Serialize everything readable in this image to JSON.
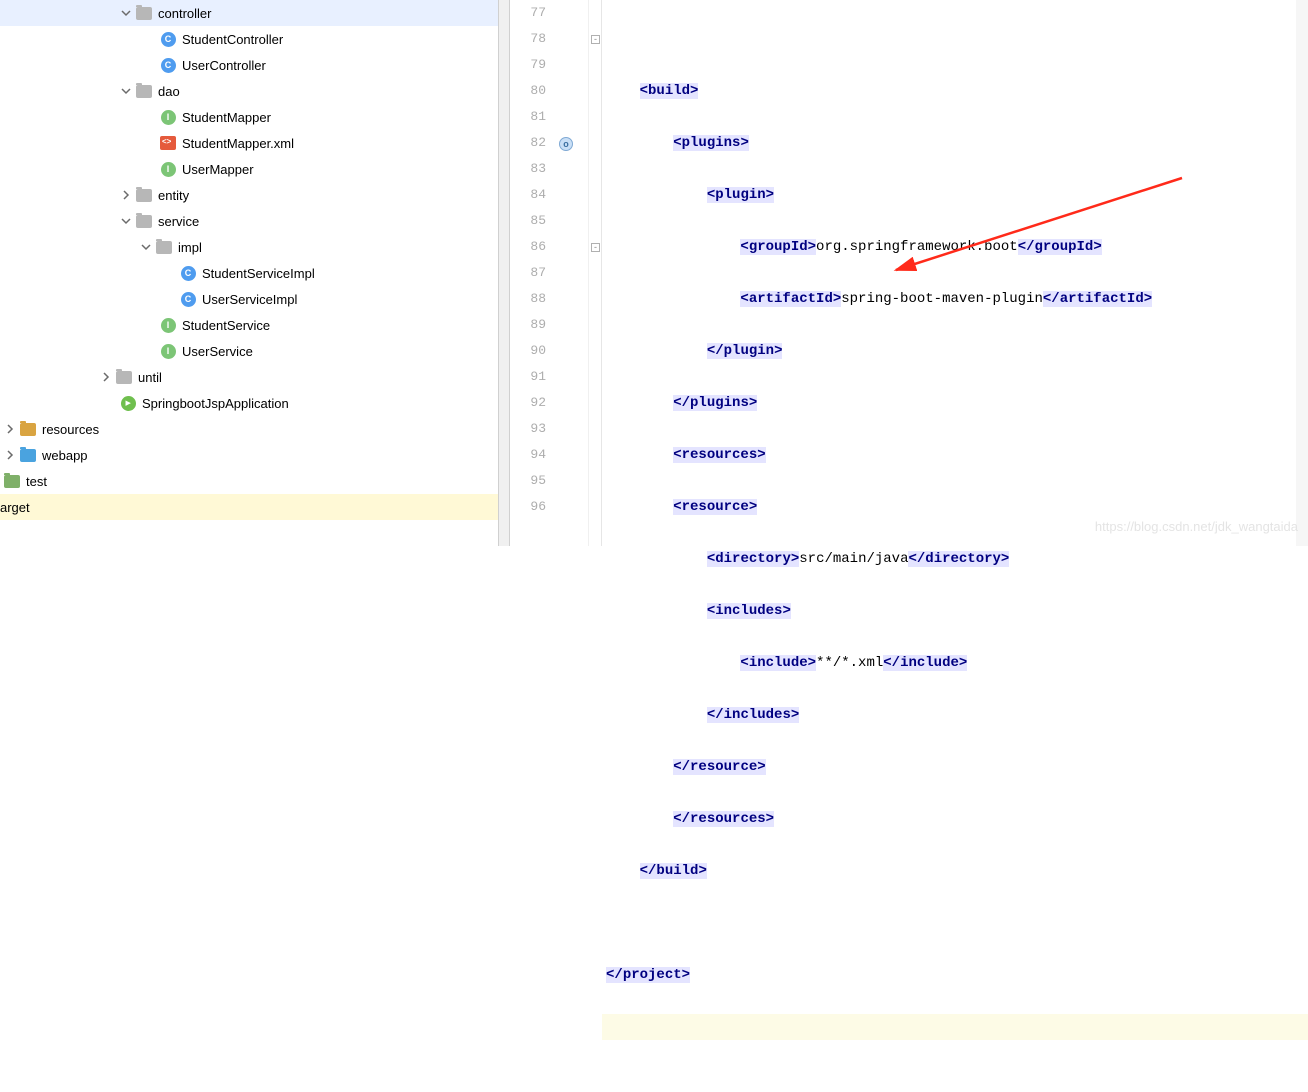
{
  "tree": {
    "controller": "controller",
    "studentController": "StudentController",
    "userController": "UserController",
    "dao": "dao",
    "studentMapper": "StudentMapper",
    "studentMapperXml": "StudentMapper.xml",
    "userMapper": "UserMapper",
    "entity": "entity",
    "service": "service",
    "impl": "impl",
    "studentServiceImpl": "StudentServiceImpl",
    "userServiceImpl": "UserServiceImpl",
    "studentService": "StudentService",
    "userService": "UserService",
    "until": "until",
    "springbootApp": "SpringbootJspApplication",
    "resources": "resources",
    "webapp": "webapp",
    "test": "test",
    "target": "arget"
  },
  "lines": {
    "l77": "77",
    "l78": "78",
    "l79": "79",
    "l80": "80",
    "l81": "81",
    "l82": "82",
    "l83": "83",
    "l84": "84",
    "l85": "85",
    "l86": "86",
    "l87": "87",
    "l88": "88",
    "l89": "89",
    "l90": "90",
    "l91": "91",
    "l92": "92",
    "l93": "93",
    "l94": "94",
    "l95": "95",
    "l96": "96"
  },
  "code": {
    "build": "build",
    "plugins": "plugins",
    "plugin": "plugin",
    "groupId": "groupId",
    "groupIdVal": "org.springframework.boot",
    "artifactId": "artifactId",
    "artifactIdVal": "spring-boot-maven-plugin",
    "resources": "resources",
    "resource": "resource",
    "directory": "directory",
    "directoryVal": "src/main/java",
    "includes": "includes",
    "include": "include",
    "includeVal": "**/*.xml",
    "project": "project"
  },
  "watermark": "https://blog.csdn.net/jdk_wangtaida"
}
